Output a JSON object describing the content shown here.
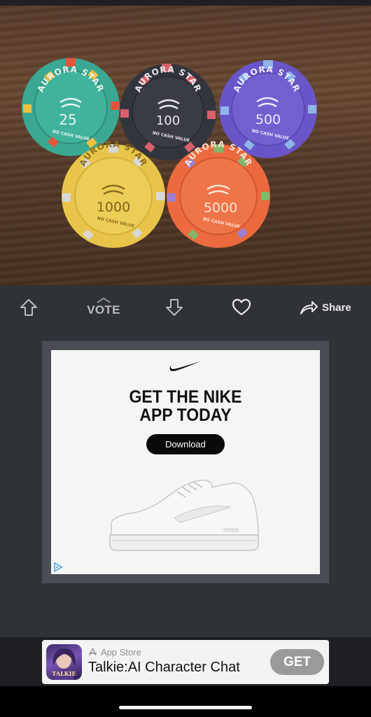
{
  "photo": {
    "chips": [
      {
        "brand": "AURORA STAR",
        "value": "25",
        "note": "NO CASH VALUE",
        "color": "#3aa892"
      },
      {
        "brand": "AURORA STAR",
        "value": "100",
        "note": "NO CASH VALUE",
        "color": "#33353d"
      },
      {
        "brand": "AURORA STAR",
        "value": "500",
        "note": "NO CASH VALUE",
        "color": "#6a55c8"
      },
      {
        "brand": "AURORA STAR",
        "value": "1000",
        "note": "NO CASH VALUE",
        "color": "#e8c54a"
      },
      {
        "brand": "AURORA STAR",
        "value": "5000",
        "note": "NO CASH VALUE",
        "color": "#ec6a3e"
      }
    ]
  },
  "actions": {
    "upvote_icon": "arrow-up-outline-icon",
    "vote_label": "VOTE",
    "downvote_icon": "arrow-down-outline-icon",
    "like_icon": "heart-outline-icon",
    "share_label": "Share",
    "share_icon": "share-arrow-icon"
  },
  "ad": {
    "brand_icon": "nike-swoosh-icon",
    "headline_line1": "GET THE NIKE",
    "headline_line2": "APP TODAY",
    "cta_label": "Download",
    "product_icon": "white-sneaker-image",
    "adchoices_icon": "adchoices-icon"
  },
  "app_banner": {
    "store_label": "App Store",
    "app_name": "Talkie:AI Character Chat",
    "app_icon_text": "TALKIE",
    "get_label": "GET"
  },
  "colors": {
    "background": "#2f3236",
    "ad_frame": "#4a4e54",
    "icon_gray": "#b9bcc1"
  }
}
